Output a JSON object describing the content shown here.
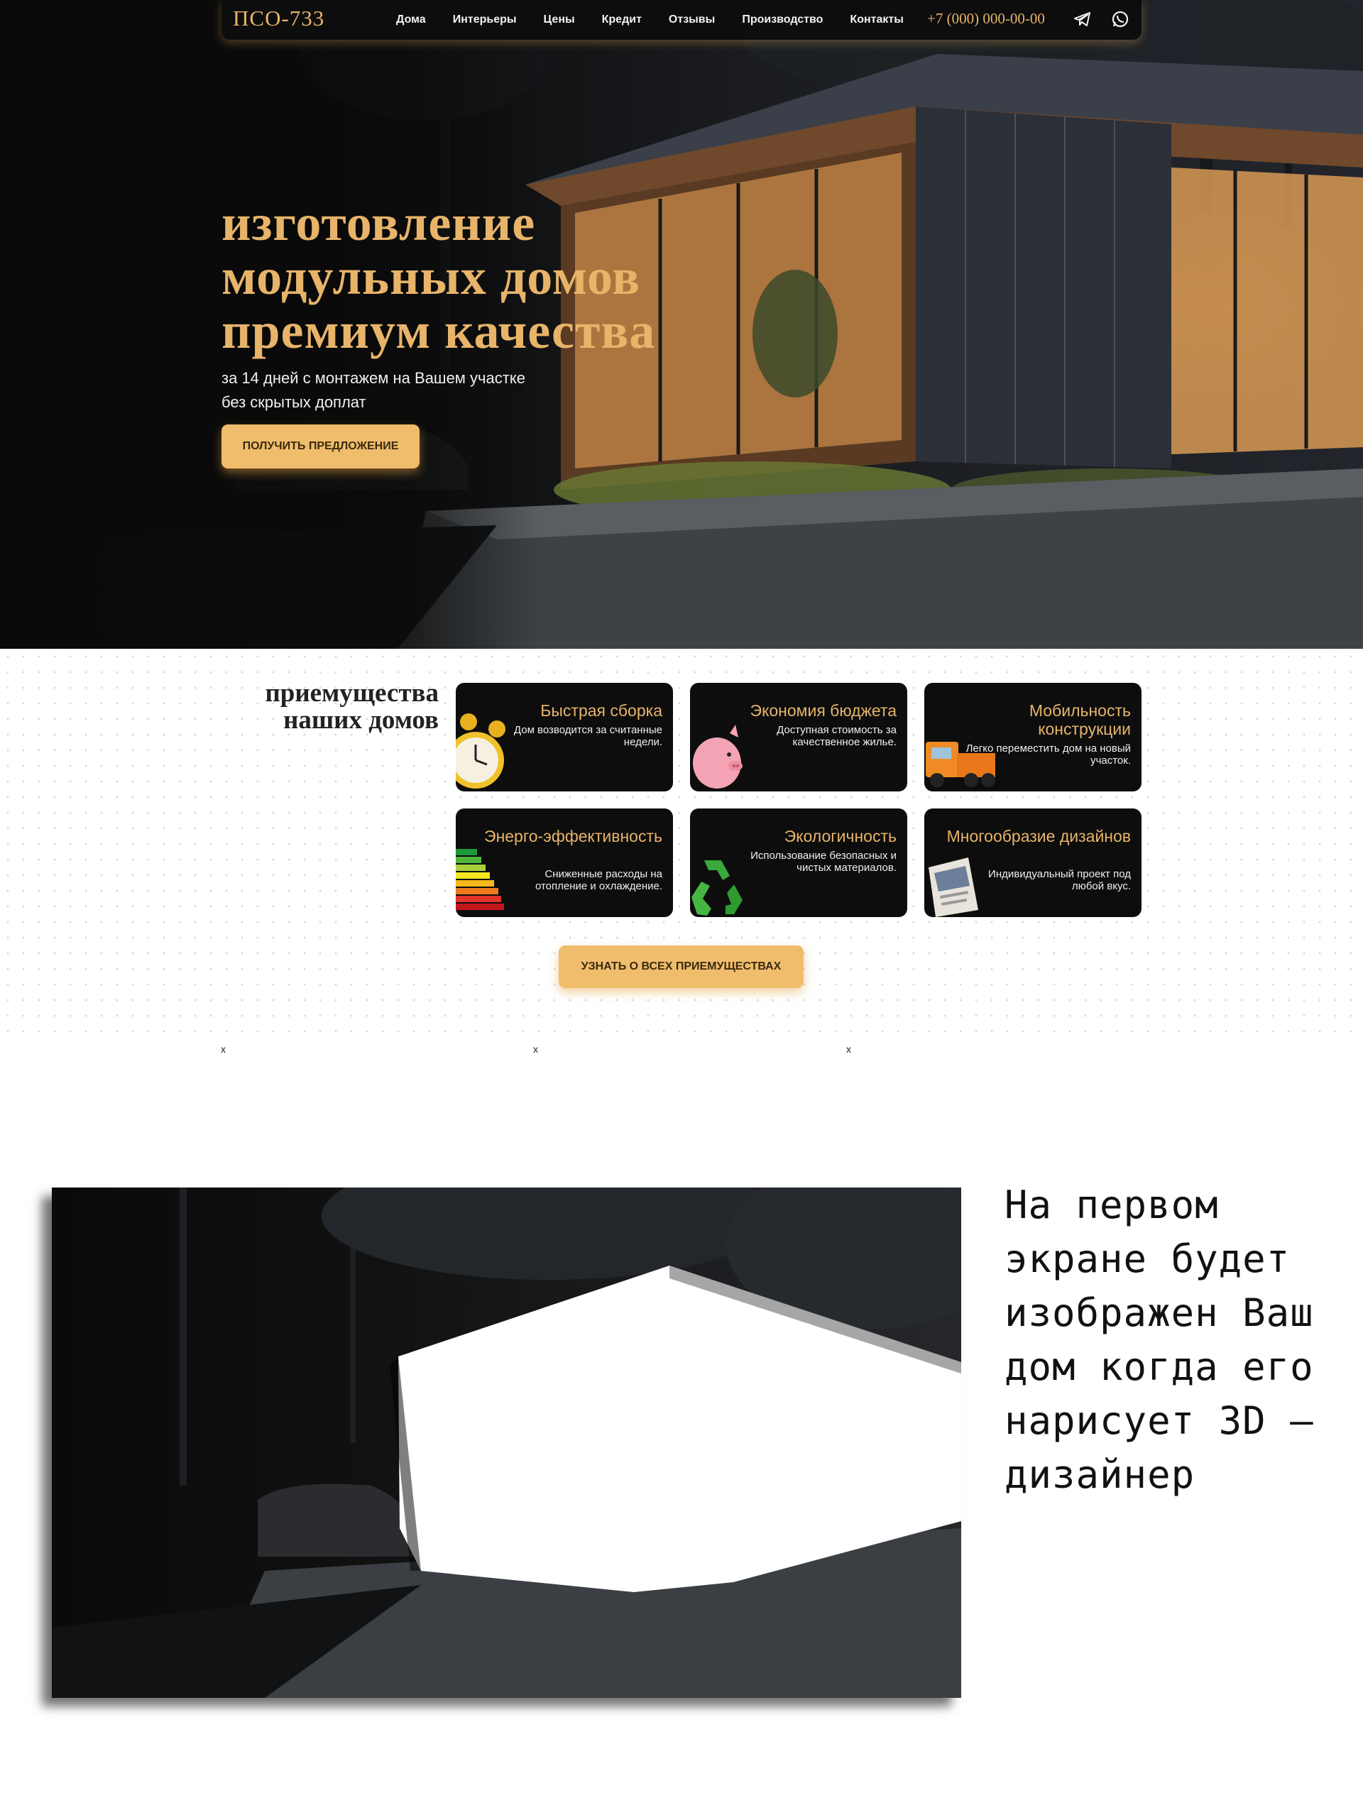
{
  "header": {
    "logo": "ПСО-733",
    "nav": [
      "Дома",
      "Интерьеры",
      "Цены",
      "Кредит",
      "Отзывы",
      "Производство",
      "Контакты"
    ],
    "phone": "+7 (000) 000-00-00",
    "icons": [
      "telegram-icon",
      "whatsapp-icon"
    ]
  },
  "hero": {
    "title_lines": [
      "изготовление",
      "модульных домов",
      "премиум качества"
    ],
    "subtitle_lines": [
      "за 14 дней с монтажем на Вашем участке",
      "без скрытых доплат"
    ],
    "cta": "ПОЛУЧИТЬ ПРЕДЛОЖЕНИЕ"
  },
  "advantages": {
    "title_lines": [
      "приемущества",
      "наших домов"
    ],
    "cards": [
      {
        "title": "Быстрая сборка",
        "desc": "Дом возводится за считанные недели.",
        "icon": "alarm-clock-icon"
      },
      {
        "title": "Экономия бюджета",
        "desc": "Доступная стоимость за качественное жилье.",
        "icon": "piggy-bank-icon"
      },
      {
        "title": "Мобильность конструкции",
        "desc": "Легко переместить дом на новый участок.",
        "icon": "truck-icon"
      },
      {
        "title": "Энерго-эффективность",
        "desc": "Сниженные расходы на отопление и охлаждение.",
        "icon": "energy-rating-icon"
      },
      {
        "title": "Экологичность",
        "desc": "Использование безопасных и чистых материалов.",
        "icon": "recycle-icon"
      },
      {
        "title": "Многообразие дизайнов",
        "desc": "Индивидуальный проект под любой вкус.",
        "icon": "catalog-icon"
      }
    ],
    "cta": "УЗНАТЬ О ВСЕХ ПРИЕМУЩЕСТВАХ",
    "markers": [
      "x",
      "x",
      "x"
    ]
  },
  "preview": {
    "text": "На первом экране будет изображен Ваш дом когда его нарисует 3D – дизайнер"
  },
  "colors": {
    "accent": "#e7b46a",
    "button": "#f0bd6c",
    "dark": "#0d0d0d"
  }
}
